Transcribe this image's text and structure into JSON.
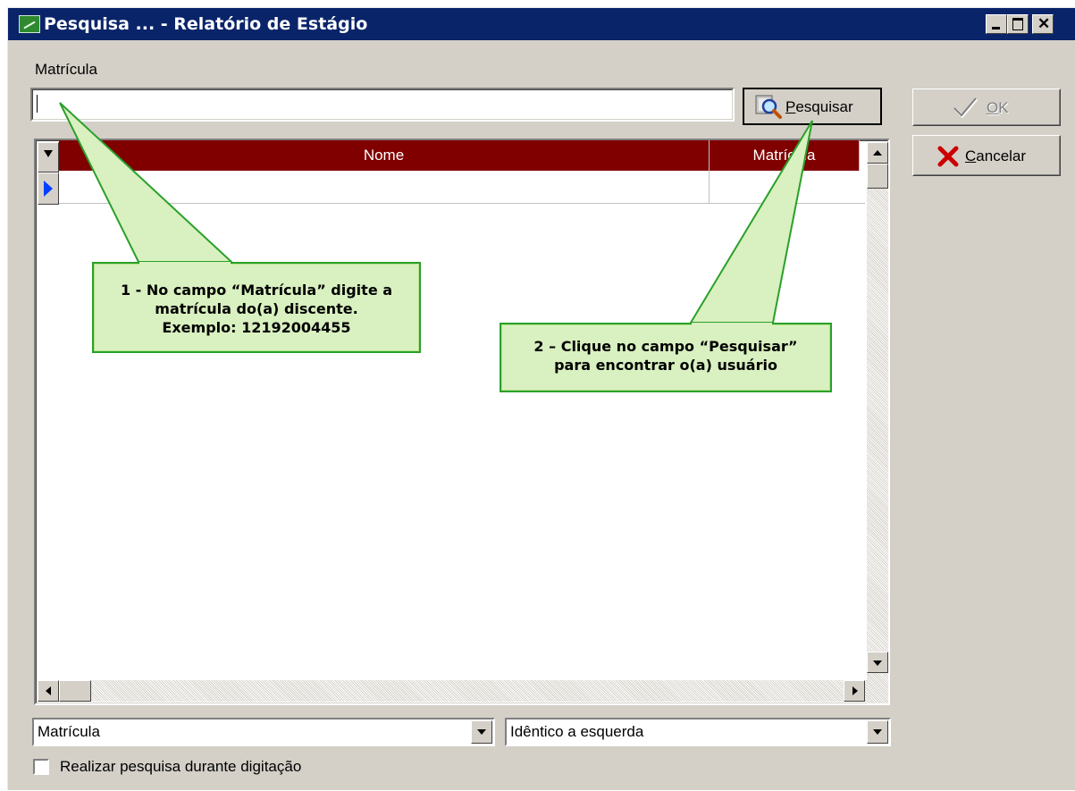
{
  "window": {
    "title": "Pesquisa ... - Relatório de Estágio",
    "controls": [
      "minimize-icon",
      "maximize-icon",
      "close-icon"
    ]
  },
  "search": {
    "field_label": "Matrícula",
    "input_value": "",
    "search_button_label": "Pesquisar"
  },
  "actions": {
    "ok_label": "OK",
    "cancel_label": "Cancelar"
  },
  "grid": {
    "columns": [
      "Nome",
      "Matrícula"
    ],
    "rows": [
      {
        "nome": "",
        "matricula": ""
      }
    ]
  },
  "filters": {
    "field_select_value": "Matrícula",
    "mode_select_value": "Idêntico a esquerda",
    "live_search_label": "Realizar pesquisa durante digitação",
    "live_search_checked": false
  },
  "annotations": {
    "callout1": {
      "line1": "1 - No campo “Matrícula” digite a",
      "line2": "matrícula do(a) discente.",
      "line3": "Exemplo: 12192004455"
    },
    "callout2": {
      "line1": "2 – Clique no campo “Pesquisar”",
      "line2": "para encontrar o(a) usuário"
    }
  },
  "colors": {
    "titlebar": "#0a246a",
    "grid_header": "#800000",
    "callout_fill": "#d9f0c0",
    "callout_border": "#2aa02a",
    "cancel_icon": "#cc0000"
  }
}
